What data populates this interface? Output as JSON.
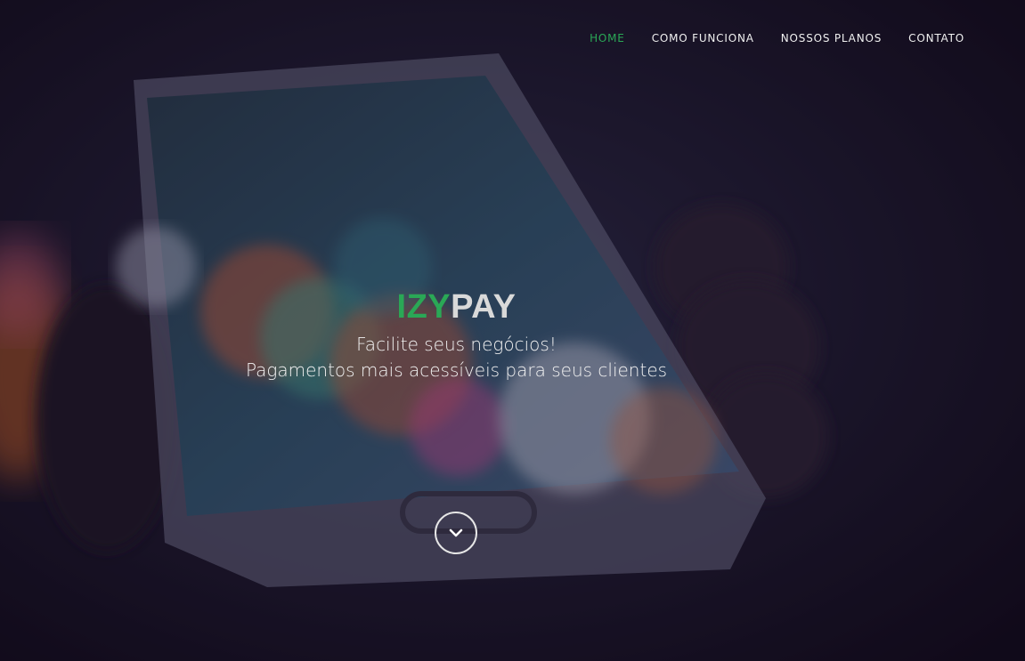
{
  "nav": {
    "items": [
      {
        "label": "HOME",
        "active": true
      },
      {
        "label": "COMO FUNCIONA",
        "active": false
      },
      {
        "label": "NOSSOS PLANOS",
        "active": false
      },
      {
        "label": "CONTATO",
        "active": false
      }
    ]
  },
  "hero": {
    "brand_part1": "IZY",
    "brand_part2": "PAY",
    "tagline_line1": "Facilite seus negócios!",
    "tagline_line2": "Pagamentos mais acessíveis para seus clientes",
    "scroll_icon": "chevron-down-icon"
  },
  "colors": {
    "accent": "#2aa856",
    "brand_secondary": "#d9d9d9",
    "overlay": "#1a0f26"
  }
}
